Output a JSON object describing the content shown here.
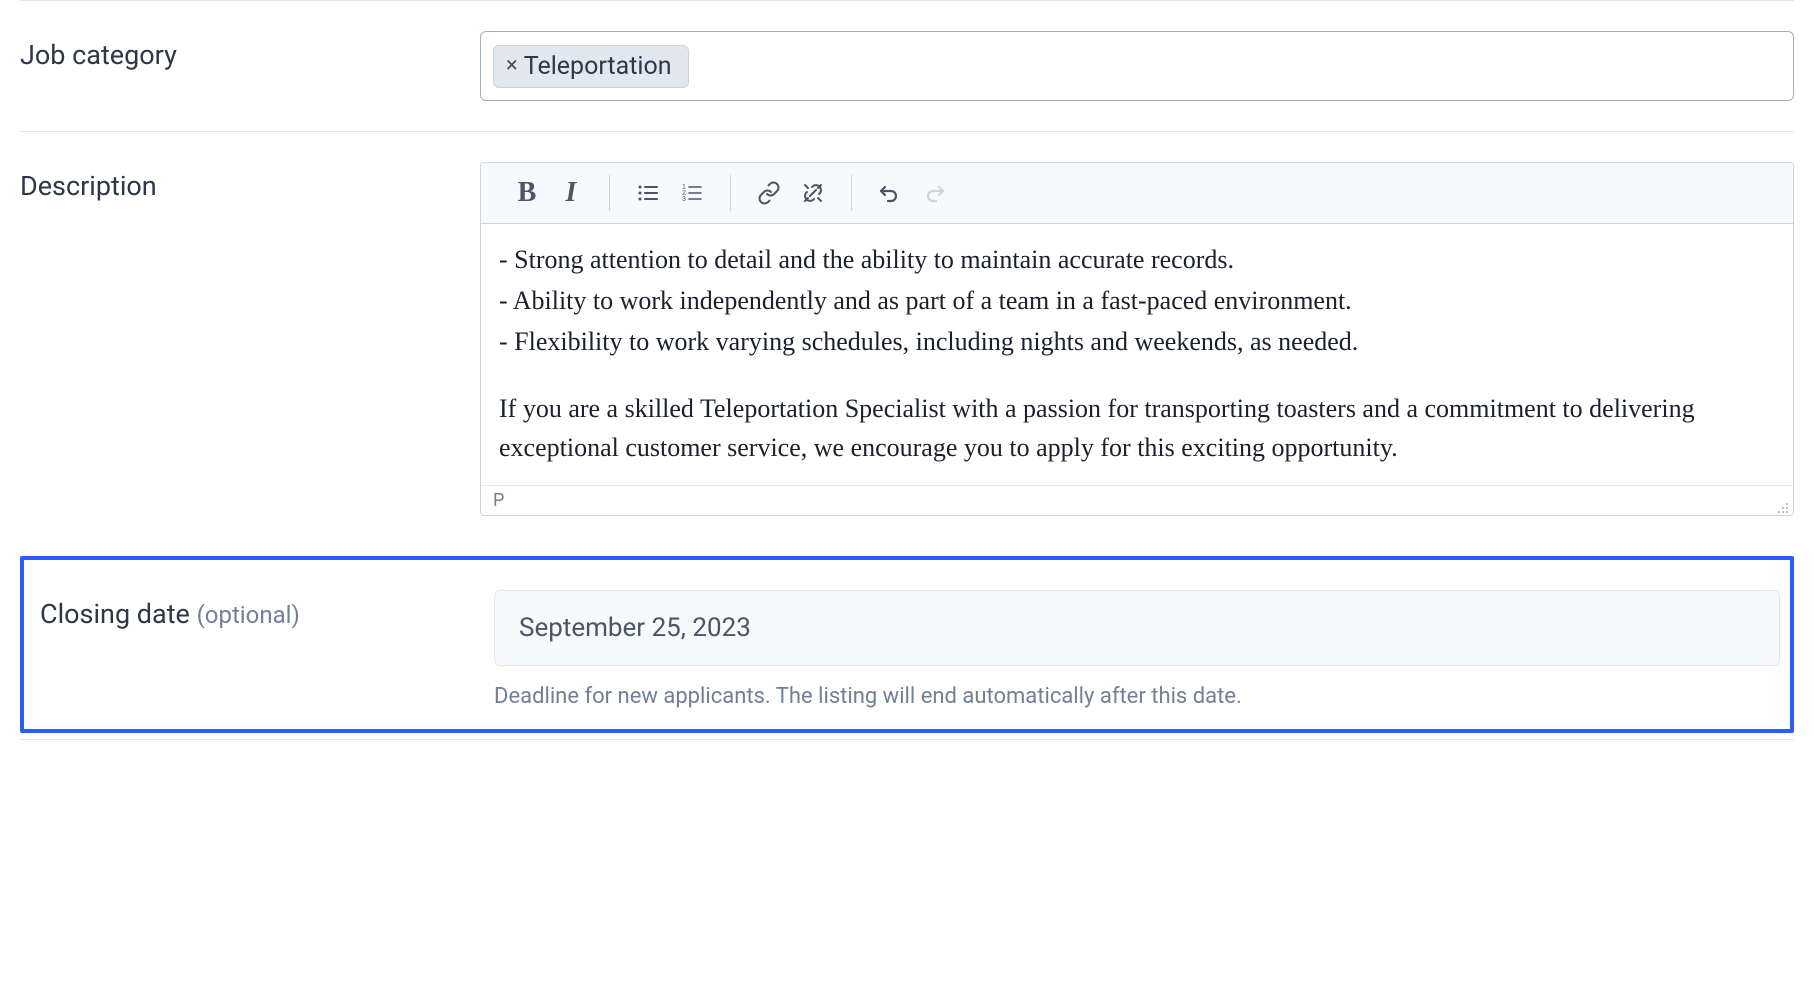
{
  "jobCategory": {
    "label": "Job category",
    "tags": [
      {
        "label": "Teleportation"
      }
    ]
  },
  "description": {
    "label": "Description",
    "toolbar": {
      "bold": "B",
      "italic": "I"
    },
    "content": {
      "line1": "- Strong attention to detail and the ability to maintain accurate records.",
      "line2": "- Ability to work independently and as part of a team in a fast-paced environment.",
      "line3": "- Flexibility to work varying schedules, including nights and weekends, as needed.",
      "line4": "If you are a skilled Teleportation Specialist with a passion for transporting toasters and a commitment to delivering exceptional customer service, we encourage you to apply for this exciting opportunity."
    },
    "statusPath": "P"
  },
  "closingDate": {
    "label": "Closing date ",
    "optional": "(optional)",
    "value": "September 25, 2023",
    "helper": "Deadline for new applicants. The listing will end automatically after this date."
  }
}
